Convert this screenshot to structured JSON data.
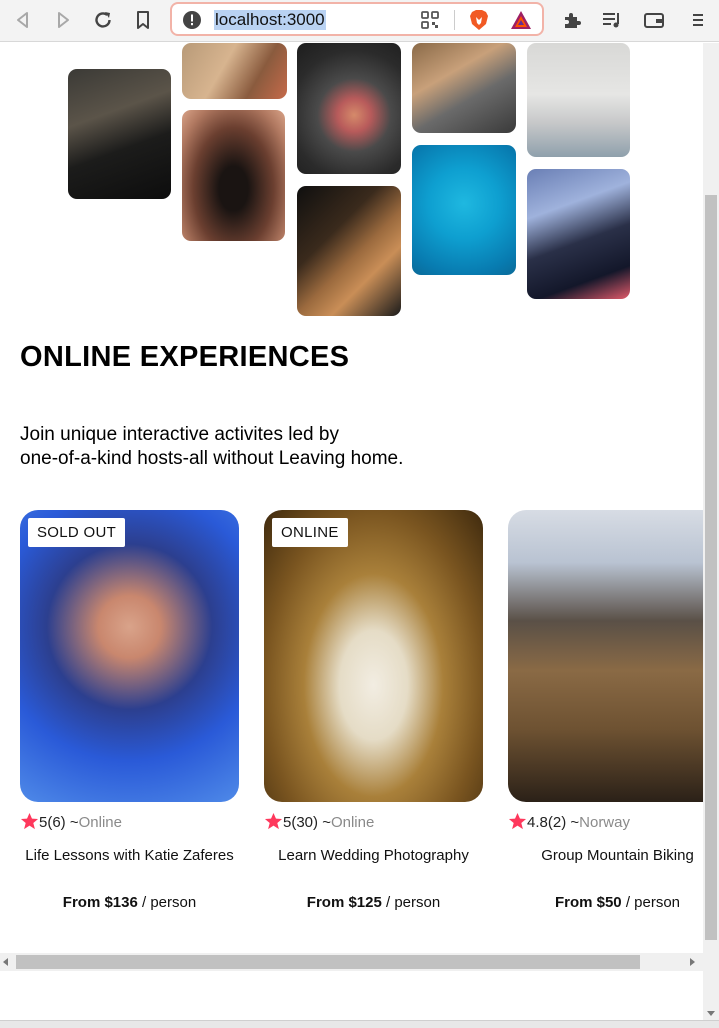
{
  "browser": {
    "url": "localhost:3000"
  },
  "hero": {
    "tiles": [
      {
        "name": "cooking-photo"
      },
      {
        "name": "chef-photo"
      },
      {
        "name": "doorway-dancer-photo"
      },
      {
        "name": "plated-dish-photo"
      },
      {
        "name": "guitar-photo"
      },
      {
        "name": "piano-photo"
      },
      {
        "name": "swimmer-photo"
      },
      {
        "name": "meditation-photo"
      },
      {
        "name": "singer-photo"
      }
    ]
  },
  "section": {
    "heading": "ONLINE EXPERIENCES",
    "intro_line1": "Join unique interactive activites led by",
    "intro_line2": "one-of-a-kind hosts-all without Leaving home."
  },
  "cards": [
    {
      "badge": "SOLD OUT",
      "rating": "5",
      "count": "(6)",
      "separator": "~",
      "location": "Online",
      "title": "Life Lessons with Katie Zaferes",
      "price": "From $136",
      "per": "/ person"
    },
    {
      "badge": "ONLINE",
      "rating": "5",
      "count": "(30)",
      "separator": "~",
      "location": "Online",
      "title": "Learn Wedding Photography",
      "price": "From $125",
      "per": "/ person"
    },
    {
      "rating": "4.8",
      "count": "(2)",
      "separator": "~",
      "location": "Norway",
      "title": "Group Mountain Biking",
      "price": "From $50",
      "per": "/ person"
    }
  ],
  "colors": {
    "star": "#fe385c",
    "url_highlight": "#b9d2f2",
    "urlbar_border": "#f2b3a8"
  }
}
